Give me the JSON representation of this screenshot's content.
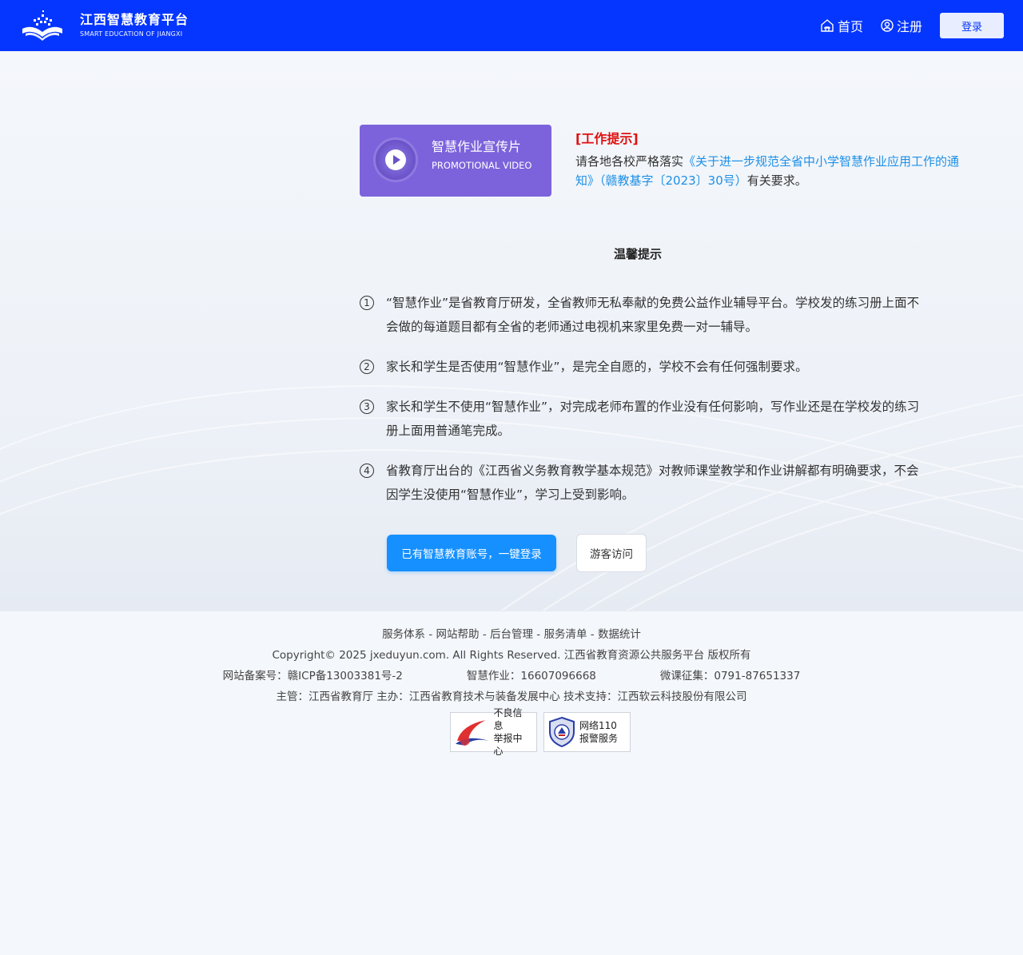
{
  "header": {
    "logo_title": "江西智慧教育平台",
    "logo_subtitle": "SMART EDUCATION OF JIANGXI",
    "nav_home": "首页",
    "nav_register": "注册",
    "login_label": "登录",
    "bg_color": "#0536ff"
  },
  "video": {
    "title": "智慧作业宣传片",
    "subtitle": "PROMOTIONAL VIDEO",
    "color": "#7c63dc"
  },
  "notice": {
    "title": "[工作提示]",
    "prefix": "请各地各校严格落实",
    "link": "《关于进一步规范全省中小学智慧作业应用工作的通知》（赣教基字〔2023〕30号）",
    "suffix": "有关要求。"
  },
  "tips": {
    "heading": "温馨提示",
    "items": [
      {
        "num": "1",
        "text": "“智慧作业”是省教育厅研发，全省教师无私奉献的免费公益作业辅导平台。学校发的练习册上面不会做的每道题目都有全省的老师通过电视机来家里免费一对一辅导。"
      },
      {
        "num": "2",
        "text": "家长和学生是否使用“智慧作业”，是完全自愿的，学校不会有任何强制要求。"
      },
      {
        "num": "3",
        "text": "家长和学生不使用“智慧作业”，对完成老师布置的作业没有任何影响，写作业还是在学校发的练习册上面用普通笔完成。"
      },
      {
        "num": "4",
        "text": "省教育厅出台的《江西省义务教育教学基本规范》对教师课堂教学和作业讲解都有明确要求，不会因学生没使用“智慧作业”，学习上受到影响。"
      }
    ]
  },
  "actions": {
    "primary": "已有智慧教育账号，一键登录",
    "guest": "游客访问"
  },
  "footer": {
    "links": [
      "服务体系",
      "网站帮助",
      "后台管理",
      "服务清单",
      "数据统计"
    ],
    "separator": " - ",
    "copyright": "Copyright© 2025  jxeduyun.com. All Rights Reserved. 江西省教育资源公共服务平台  版权所有",
    "icp": "网站备案号：赣ICP备13003381号-2",
    "homework_phone": "智慧作业：16607096668",
    "microlesson_phone": "微课征集：0791-87651337",
    "sponsors": "主管：江西省教育厅   主办：江西省教育技术与装备发展中心   技术支持：江西软云科技股份有限公司",
    "badge1_line1": "不良信息",
    "badge1_line2": "举报中心",
    "badge2_line1": "网络110",
    "badge2_line2": "报警服务"
  }
}
